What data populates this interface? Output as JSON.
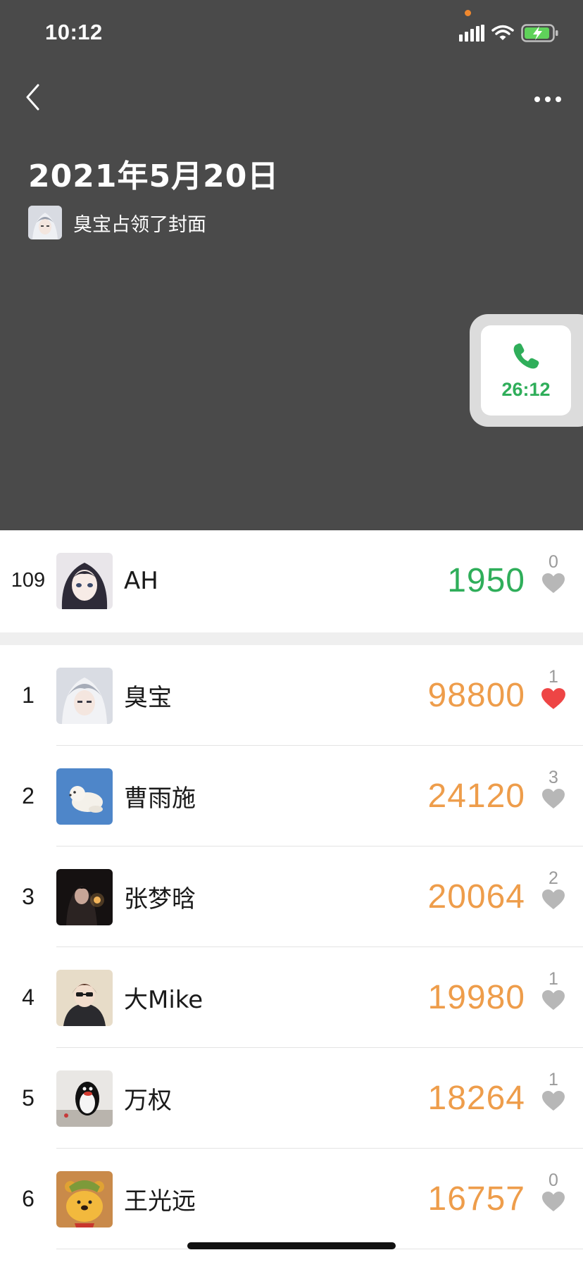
{
  "status_bar": {
    "time": "10:12"
  },
  "cover": {
    "date": "2021年5月20日",
    "owner_text": "臭宝占领了封面"
  },
  "call_widget": {
    "duration": "26:12"
  },
  "my_row": {
    "rank": "109",
    "name": "AH",
    "steps": "1950",
    "likes": "0",
    "liked": false
  },
  "rows": [
    {
      "rank": "1",
      "name": "臭宝",
      "steps": "98800",
      "likes": "1",
      "liked": true
    },
    {
      "rank": "2",
      "name": "曹雨施",
      "steps": "24120",
      "likes": "3",
      "liked": false
    },
    {
      "rank": "3",
      "name": "张梦晗",
      "steps": "20064",
      "likes": "2",
      "liked": false
    },
    {
      "rank": "4",
      "name": "大Mike",
      "steps": "19980",
      "likes": "1",
      "liked": false
    },
    {
      "rank": "5",
      "name": "万权",
      "steps": "18264",
      "likes": "1",
      "liked": false
    },
    {
      "rank": "6",
      "name": "王光远",
      "steps": "16757",
      "likes": "0",
      "liked": false
    }
  ],
  "colors": {
    "cover_bg": "#4a4a4a",
    "own_steps": "#2fae5a",
    "rank_steps": "#ee9d4b",
    "liked_heart": "#ee4545",
    "heart_gray": "#b7b7b7"
  },
  "icons": {
    "back": "chevron-left-icon",
    "more": "ellipsis-icon",
    "call": "phone-icon",
    "like": "heart-icon",
    "signal": "signal-icon",
    "wifi": "wifi-icon",
    "battery": "battery-charging-icon"
  }
}
